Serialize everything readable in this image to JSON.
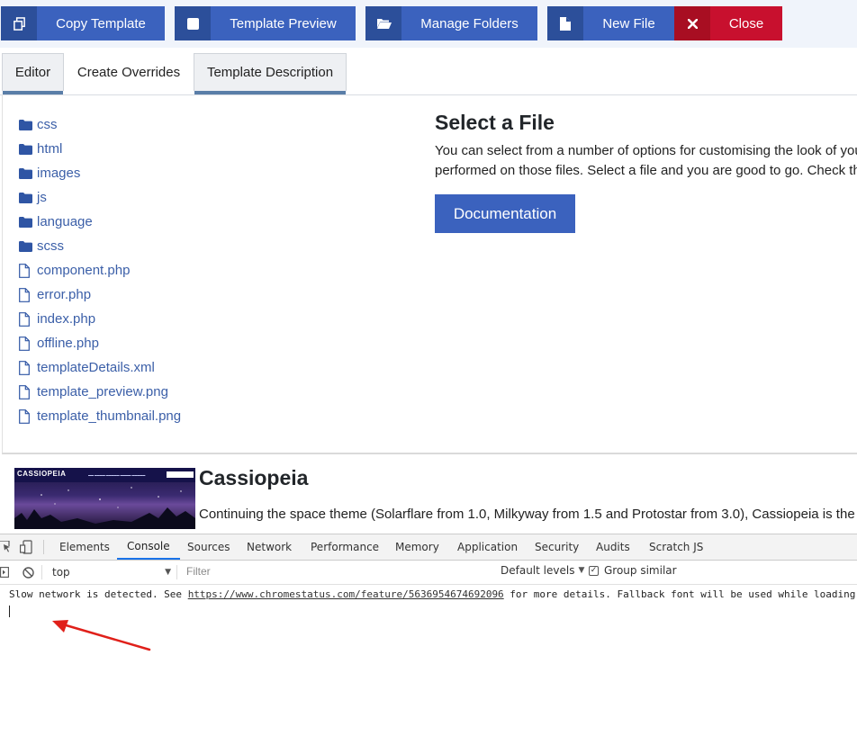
{
  "toolbar": {
    "buttons": [
      {
        "label": "Copy Template",
        "icon": "copy-icon"
      },
      {
        "label": "Template Preview",
        "icon": "square-icon"
      },
      {
        "label": "Manage Folders",
        "icon": "folder-open-icon"
      },
      {
        "label": "New File",
        "icon": "file-icon"
      },
      {
        "label": "Close",
        "icon": "close-icon"
      }
    ],
    "colors": {
      "primary": "#3b62be",
      "primary_dark": "#2c4f9a",
      "danger": "#c8102e",
      "danger_dark": "#a80e22"
    }
  },
  "tabs": [
    {
      "label": "Editor"
    },
    {
      "label": "Create Overrides"
    },
    {
      "label": "Template Description"
    }
  ],
  "file_tree": {
    "folders": [
      "css",
      "html",
      "images",
      "js",
      "language",
      "scss"
    ],
    "files": [
      "component.php",
      "error.php",
      "index.php",
      "offline.php",
      "templateDetails.xml",
      "template_preview.png",
      "template_thumbnail.png"
    ]
  },
  "select_file": {
    "title": "Select a File",
    "line1": "You can select from a number of options for customising the look of you",
    "line2": "performed on those files. Select a file and you are good to go. Check th",
    "button": "Documentation"
  },
  "template_info": {
    "thumb_brand": "CASSIOPEIA",
    "title": "Cassiopeia",
    "description": "Continuing the space theme (Solarflare from 1.0, Milkyway from 1.5 and Protostar from 3.0), Cassiopeia is the"
  },
  "devtools": {
    "tabs": [
      "Elements",
      "Console",
      "Sources",
      "Network",
      "Performance",
      "Memory",
      "Application",
      "Security",
      "Audits",
      "Scratch JS"
    ],
    "active_tab": "Console",
    "context": "top",
    "filter_placeholder": "Filter",
    "levels": "Default levels",
    "group_similar": "Group similar",
    "group_similar_checked": true,
    "message_prefix": "Slow network is detected. See ",
    "message_link": "https://www.chromestatus.com/feature/5636954674692096",
    "message_suffix": " for more details. Fallback font will be used while loading"
  }
}
